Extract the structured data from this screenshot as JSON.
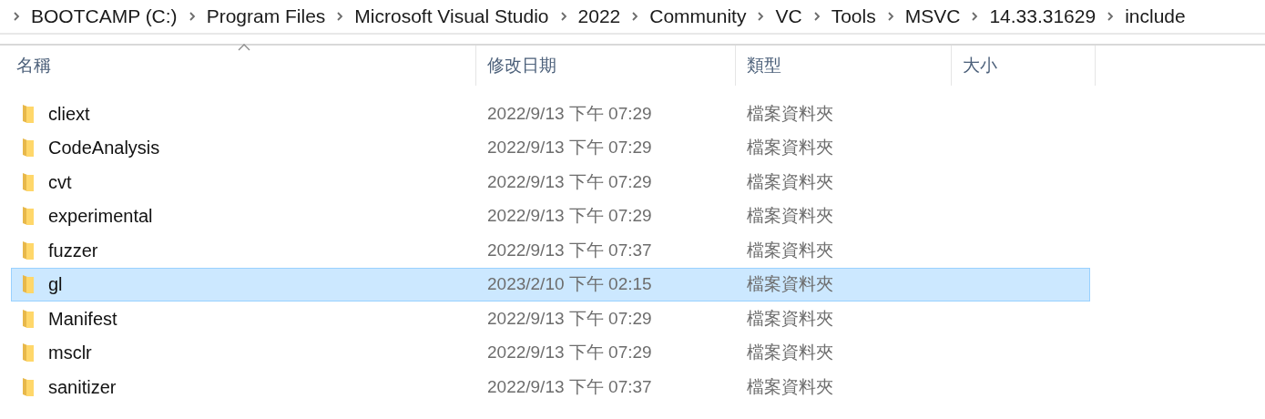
{
  "breadcrumb": [
    "BOOTCAMP (C:)",
    "Program Files",
    "Microsoft Visual Studio",
    "2022",
    "Community",
    "VC",
    "Tools",
    "MSVC",
    "14.33.31629",
    "include"
  ],
  "columns": [
    {
      "label": "名稱",
      "sorted": true
    },
    {
      "label": "修改日期",
      "sorted": false
    },
    {
      "label": "類型",
      "sorted": false
    },
    {
      "label": "大小",
      "sorted": false
    }
  ],
  "rows": [
    {
      "name": "cliext",
      "modified": "2022/9/13 下午 07:29",
      "type": "檔案資料夾",
      "selected": false
    },
    {
      "name": "CodeAnalysis",
      "modified": "2022/9/13 下午 07:29",
      "type": "檔案資料夾",
      "selected": false
    },
    {
      "name": "cvt",
      "modified": "2022/9/13 下午 07:29",
      "type": "檔案資料夾",
      "selected": false
    },
    {
      "name": "experimental",
      "modified": "2022/9/13 下午 07:29",
      "type": "檔案資料夾",
      "selected": false
    },
    {
      "name": "fuzzer",
      "modified": "2022/9/13 下午 07:37",
      "type": "檔案資料夾",
      "selected": false
    },
    {
      "name": "gl",
      "modified": "2023/2/10 下午 02:15",
      "type": "檔案資料夾",
      "selected": true
    },
    {
      "name": "Manifest",
      "modified": "2022/9/13 下午 07:29",
      "type": "檔案資料夾",
      "selected": false
    },
    {
      "name": "msclr",
      "modified": "2022/9/13 下午 07:29",
      "type": "檔案資料夾",
      "selected": false
    },
    {
      "name": "sanitizer",
      "modified": "2022/9/13 下午 07:37",
      "type": "檔案資料夾",
      "selected": false
    }
  ]
}
